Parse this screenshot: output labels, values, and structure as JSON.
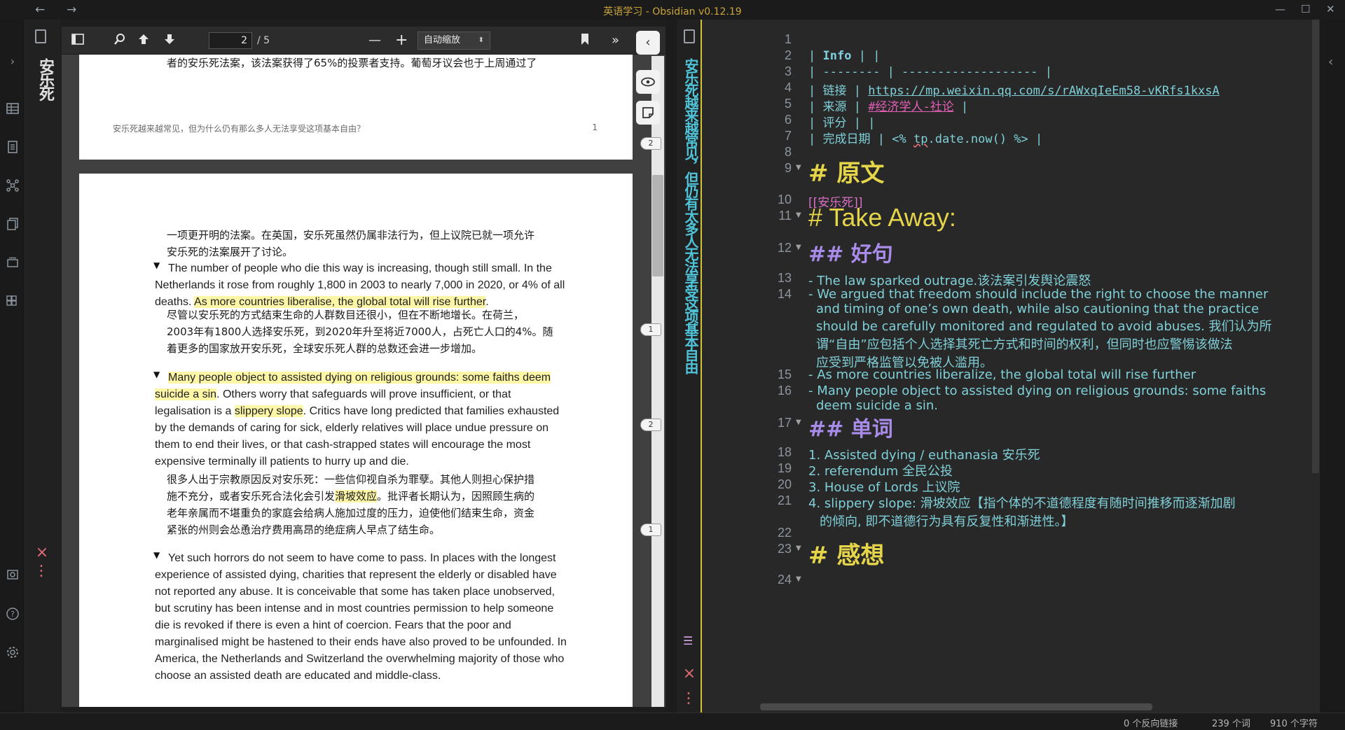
{
  "window": {
    "title": "英语学习 - Obsidian v0.12.19",
    "nav_back": "←",
    "nav_forward": "→",
    "minimize": "—",
    "maximize": "☐",
    "close": "✕"
  },
  "left_pane": {
    "tab_title": "安乐死",
    "toolbar": {
      "page_current": "2",
      "page_total": "/ 5",
      "zoom": "自动缩放"
    },
    "page1": {
      "lines": [
        "者的安乐死法案，该法案获得了65%的投票者支持。葡萄牙议会也于上周通过了"
      ],
      "footer": "安乐死越来越常见，但为什么仍有那么多人无法享受这项基本自由？",
      "footer_page": "1"
    },
    "page2": {
      "zh1_l1": "一项更开明的法案。在英国，安乐死虽然仍属非法行为，但上议院已就一项允许",
      "zh1_l2": "安乐死的法案展开了讨论。",
      "en1_l1": "The number of people who die this way is increasing, though still small. In the",
      "en1_l2": "Netherlands it rose from roughly 1,800 in 2003 to nearly 7,000 in 2020, or 4% of all",
      "en1_l3a": "deaths. ",
      "en1_l3b": "As more countries liberalise, the global total will rise further",
      "en1_l3c": ".",
      "zh2_l1": "尽管以安乐死的方式结束生命的人群数目还很小，但在不断地增长。在荷兰，",
      "zh2_l2": "2003年有1800人选择安乐死，到2020年升至将近7000人，占死亡人口的4%。随",
      "zh2_l3": "着更多的国家放开安乐死，全球安乐死人群的总数还会进一步增加。",
      "en2_l1": "Many people object to assisted dying on religious grounds: some faiths deem",
      "en2_l2a": "suicide a sin",
      "en2_l2b": ". Others worry that safeguards will prove insufficient, or that",
      "en2_l3a": "legalisation is a ",
      "en2_l3b": "slippery slope",
      "en2_l3c": ". Critics have long predicted that families exhausted",
      "en2_l4": "by the demands of caring for sick, elderly relatives will place undue pressure on",
      "en2_l5": "them to end their lives, or that cash-strapped states will encourage the most",
      "en2_l6": "expensive terminally ill patients to hurry up and die.",
      "zh3_l1": "很多人出于宗教原因反对安乐死：一些信仰视自杀为罪孽。其他人则担心保护措",
      "zh3_l2a": "施不充分，或者安乐死合法化会引发",
      "zh3_l2b": "滑坡效应",
      "zh3_l2c": "。批评者长期认为，因照顾生病的",
      "zh3_l3": "老年亲属而不堪重负的家庭会给病人施加过度的压力，迫使他们结束生命，资金",
      "zh3_l4": "紧张的州则会怂恿治疗费用高昂的绝症病人早点了结生命。",
      "en3_l1": "Yet such horrors do not seem to have come to pass. In places with the longest",
      "en3_l2": "experience of assisted dying, charities that represent the elderly or disabled have",
      "en3_l3": "not reported any abuse. It is conceivable that some has taken place unobserved,",
      "en3_l4": "but scrutiny has been intense and in most countries permission to help someone",
      "en3_l5": "die is revoked if there is even a hint of coercion. Fears that the poor and",
      "en3_l6": "marginalised might be hastened to their ends have also proved to be unfounded. In",
      "en3_l7": "America, the Netherlands and Switzerland the overwhelming majority of those who",
      "en3_l8": "choose an assisted death are educated and middle-class."
    },
    "markers": [
      "2",
      "1",
      "2",
      "1"
    ]
  },
  "right_pane": {
    "tab_title": "安乐死越来越常见，但仍有太多人无法享受这项基本自由",
    "line_numbers": [
      "1",
      "2",
      "3",
      "4",
      "5",
      "6",
      "7",
      "8",
      "9",
      "10",
      "11",
      "12",
      "13",
      "14",
      "15",
      "16",
      "17",
      "18",
      "19",
      "20",
      "21",
      "22",
      "23",
      "24"
    ],
    "table": {
      "r2_label": "Info",
      "r3": "| -------- | ------------------- |",
      "r4_label": "链接",
      "r4_value": "https://mp.weixin.qq.com/s/rAWxqIeEm58-vKRfs1kxsA",
      "r5_label": "来源",
      "r5_value": "#经济学人-社论",
      "r6_label": "评分",
      "r7_label": "完成日期",
      "r7_value_a": "<%",
      "r7_value_b": "tp",
      "r7_value_c": ".date.now() %>"
    },
    "h_original": "# 原文",
    "wikilink": "[[安乐死]]",
    "h_takeaway": "# Take Away:",
    "h_good": "好句",
    "good_1": "The law sparked outrage.该法案引发舆论震怒",
    "good_2_l1": "We argued that freedom should include the right to choose the manner",
    "good_2_l2": "and timing of one’s own death, while also cautioning that the practice",
    "good_2_l3": "should be carefully monitored and regulated to avoid abuses. 我们认为所",
    "good_2_l4": "谓“自由”应包括个人选择其死亡方式和时间的权利，但同时也应警惕该做法",
    "good_2_l5": "应受到严格监管以免被人滥用。",
    "good_3": "As more countries liberalize, the global total will rise further",
    "good_4_l1": "Many people object to assisted dying on religious grounds: some faiths",
    "good_4_l2": "deem suicide a sin.",
    "h_words": "单词",
    "word_1": "1. Assisted dying / euthanasia 安乐死",
    "word_2": "2. referendum 全民公投",
    "word_3": "3. House of Lords 上议院",
    "word_4_l1": "4. slippery slope: 滑坡效应【指个体的不道德程度有随时间推移而逐渐加剧",
    "word_4_l2": "的倾向, 即不道德行为具有反复性和渐进性。】",
    "h_thoughts": "# 感想"
  },
  "status": {
    "backlinks": "0 个反向链接",
    "words": "239 个词",
    "chars": "910 个字符"
  },
  "colors": {
    "accent_yellow": "#e5d54a",
    "text_cyan": "#7fd0d8",
    "heading_purple": "#a98bea",
    "tag_pink": "#e25fb6",
    "highlight": "#fdf6a7"
  }
}
